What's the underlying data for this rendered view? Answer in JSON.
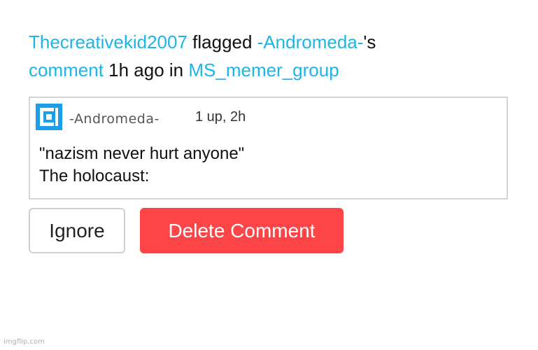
{
  "notification": {
    "flagger": "Thecreativekid2007",
    "action": " flagged ",
    "target_user": "-Andromeda-",
    "possessive": "'s",
    "object_link": "comment",
    "time_in": " 1h ago in ",
    "group": "MS_memer_group"
  },
  "comment": {
    "avatar_icon": "imgflip-logo-icon",
    "username": "-Andromeda-",
    "meta": "1 up, 2h",
    "lines": [
      "\"nazism never hurt anyone\"",
      "The holocaust:"
    ]
  },
  "actions": {
    "ignore_label": "Ignore",
    "delete_label": "Delete Comment"
  },
  "watermark": "imgflip.com",
  "colors": {
    "link": "#1eb4e6",
    "delete_button": "#fd4547",
    "card_border": "#d4d4d4",
    "avatar": "#1e9ee6"
  }
}
